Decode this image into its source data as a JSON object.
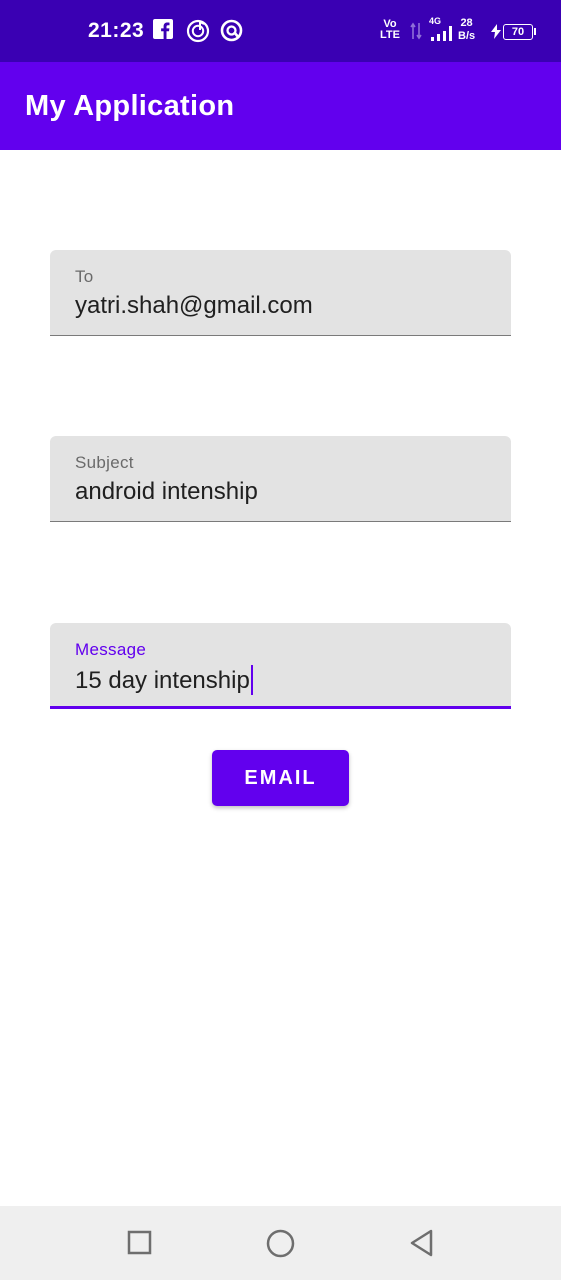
{
  "status_bar": {
    "time": "21:23",
    "icons": [
      "facebook-icon",
      "music-icon",
      "app-icon"
    ],
    "network_volte_top": "Vo",
    "network_volte_bottom": "LTE",
    "network_type": "4G",
    "speed_value": "28",
    "speed_unit": "B/s",
    "battery_level": "70"
  },
  "app_bar": {
    "title": "My Application",
    "color": "#6200ee"
  },
  "form": {
    "to": {
      "label": "To",
      "value": "yatri.shah@gmail.com"
    },
    "subject": {
      "label": "Subject",
      "value": "android intenship"
    },
    "message": {
      "label": "Message",
      "value": "15 day intenship"
    },
    "email_button_label": "EMAIL"
  },
  "nav_bar": {
    "buttons": [
      "recents-icon",
      "home-icon",
      "back-icon"
    ]
  }
}
